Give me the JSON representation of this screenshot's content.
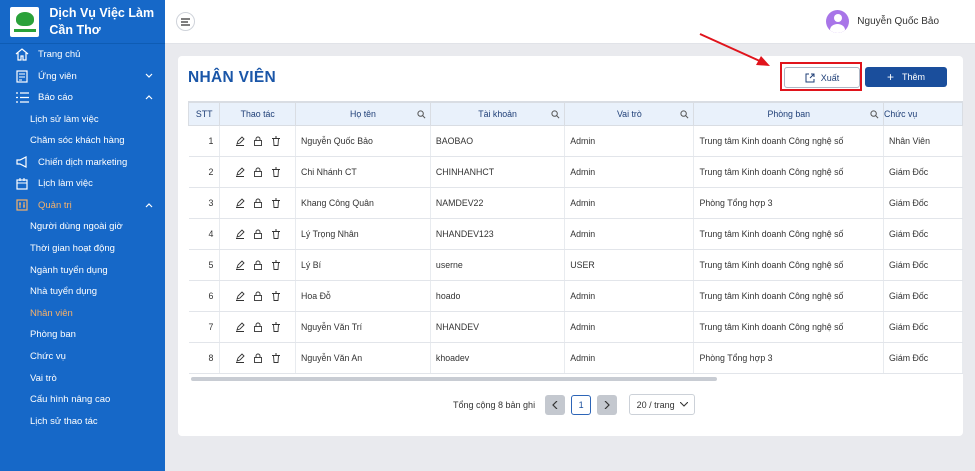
{
  "app": {
    "name": "Dịch Vụ Việc Làm Cần Thơ"
  },
  "user": {
    "name": "Nguyễn Quốc Bảo"
  },
  "sidebar": {
    "items": [
      {
        "label": "Trang chủ",
        "icon": "home-icon"
      },
      {
        "label": "Ứng viên",
        "icon": "candidate-icon",
        "expandable": true
      },
      {
        "label": "Báo cáo",
        "icon": "list-icon",
        "expandable": true,
        "expanded": true
      },
      {
        "label": "Lịch sử làm việc",
        "sub": true
      },
      {
        "label": "Chăm sóc khách hàng",
        "sub": true
      },
      {
        "label": "Chiến dịch marketing",
        "icon": "megaphone-icon"
      },
      {
        "label": "Lịch làm việc",
        "icon": "calendar-icon"
      },
      {
        "label": "Quản trị",
        "icon": "admin-icon",
        "expandable": true,
        "expanded": true,
        "active": true
      },
      {
        "label": "Người dùng ngoài giờ",
        "sub": true
      },
      {
        "label": "Thời gian hoạt động",
        "sub": true
      },
      {
        "label": "Ngành tuyển dụng",
        "sub": true
      },
      {
        "label": "Nhà tuyển dụng",
        "sub": true
      },
      {
        "label": "Nhân viên",
        "sub": true,
        "active": true
      },
      {
        "label": "Phòng ban",
        "sub": true
      },
      {
        "label": "Chức vụ",
        "sub": true
      },
      {
        "label": "Vai trò",
        "sub": true
      },
      {
        "label": "Cấu hình nâng cao",
        "sub": true
      },
      {
        "label": "Lịch sử thao tác",
        "sub": true
      }
    ]
  },
  "page": {
    "title": "NHÂN VIÊN",
    "export_label": "Xuất",
    "add_label": "Thêm"
  },
  "table": {
    "columns": [
      "STT",
      "Thao tác",
      "Họ tên",
      "Tài khoản",
      "Vai trò",
      "Phòng ban",
      "Chức vụ"
    ],
    "rows": [
      [
        "1",
        "Nguyễn Quốc Bảo",
        "BAOBAO",
        "Admin",
        "Trung tâm Kinh doanh Công nghệ số",
        "Nhân Viên"
      ],
      [
        "2",
        "Chi Nhánh CT",
        "CHINHANHCT",
        "Admin",
        "Trung tâm Kinh doanh Công nghệ số",
        "Giám Đốc"
      ],
      [
        "3",
        "Khang Công Quân",
        "NAMDEV22",
        "Admin",
        "Phòng Tổng hợp 3",
        "Giám Đốc"
      ],
      [
        "4",
        "Lý Trọng Nhân",
        "NHANDEV123",
        "Admin",
        "Trung tâm Kinh doanh Công nghệ số",
        "Giám Đốc"
      ],
      [
        "5",
        "Lý Bí",
        "userne",
        "USER",
        "Trung tâm Kinh doanh Công nghệ số",
        "Giám Đốc"
      ],
      [
        "6",
        "Hoa Đỗ",
        "hoado",
        "Admin",
        "Trung tâm Kinh doanh Công nghệ số",
        "Giám Đốc"
      ],
      [
        "7",
        "Nguyễn Văn Trí",
        "NHANDEV",
        "Admin",
        "Trung tâm Kinh doanh Công nghệ số",
        "Giám Đốc"
      ],
      [
        "8",
        "Nguyễn Văn An",
        "khoadev",
        "Admin",
        "Phòng Tổng hợp 3",
        "Giám Đốc"
      ]
    ]
  },
  "pagination": {
    "total_text": "Tổng cộng 8 bản ghi",
    "current_page": "1",
    "page_size": "20 / trang"
  },
  "colors": {
    "sidebar": "#1668c8",
    "active": "#f6b16a",
    "primary": "#1a4e9c",
    "highlight": "#e0141c"
  }
}
